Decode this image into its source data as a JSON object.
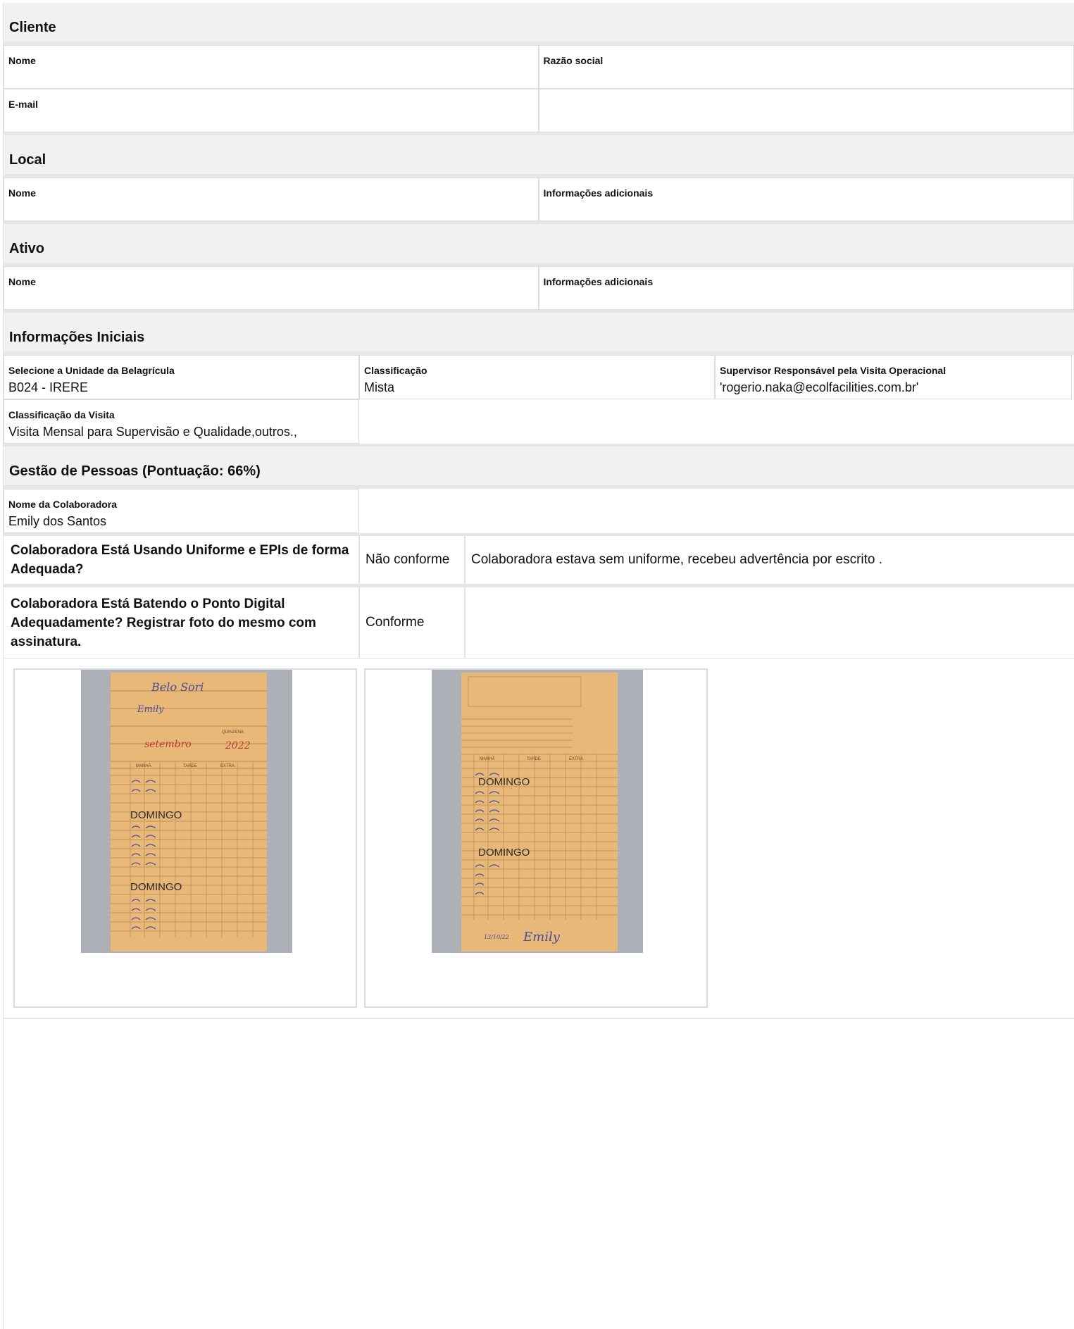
{
  "cliente": {
    "title": "Cliente",
    "nome_label": "Nome",
    "razao_label": "Razão social",
    "email_label": "E-mail"
  },
  "local": {
    "title": "Local",
    "nome_label": "Nome",
    "info_label": "Informações adicionais"
  },
  "ativo": {
    "title": "Ativo",
    "nome_label": "Nome",
    "info_label": "Informações adicionais"
  },
  "iniciais": {
    "title": "Informações Iniciais",
    "unidade_label": "Selecione a Unidade da Belagrícula",
    "unidade_value": "B024 - IRERE",
    "classificacao_label": "Classificação",
    "classificacao_value": "Mista",
    "supervisor_label": "Supervisor Responsável pela Visita Operacional",
    "supervisor_value": "'rogerio.naka@ecolfacilities.com.br'",
    "class_visita_label": "Classificação da Visita",
    "class_visita_value": "Visita Mensal para Supervisão e Qualidade,outros.,"
  },
  "gestao": {
    "title": "Gestão de Pessoas (Pontuação: 66%)",
    "colab_label": "Nome da Colaboradora",
    "colab_value": "Emily dos Santos",
    "questions": [
      {
        "text": "Colaboradora Está Usando Uniforme e EPIs de forma Adequada?",
        "answer": "Não conforme",
        "comment": "Colaboradora estava sem uniforme, recebeu advertência por escrito ."
      },
      {
        "text": "Colaboradora Está Batendo o Ponto Digital Adequadamente? Registrar foto do mesmo com assinatura.",
        "answer": "Conforme",
        "comment": ""
      }
    ],
    "photos": [
      {
        "stamps": [
          "DOMINGO",
          "DOMINGO"
        ],
        "handwriting": [
          "Belo Sori",
          "Emily",
          "setembro",
          "2022"
        ],
        "printed": [
          "QUINZENA",
          "MANHÃ",
          "TARDE",
          "EXTRA"
        ]
      },
      {
        "stamps": [
          "DOMINGO",
          "DOMINGO"
        ],
        "handwriting": [
          "Emily",
          "13/10/22"
        ],
        "printed": [
          "MANHÃ",
          "TARDE",
          "EXTRA"
        ]
      }
    ]
  },
  "colors": {
    "section_bg": "#f1f1f1",
    "card_paper": "#e8b878",
    "photo_bg": "#aeb0b8"
  }
}
